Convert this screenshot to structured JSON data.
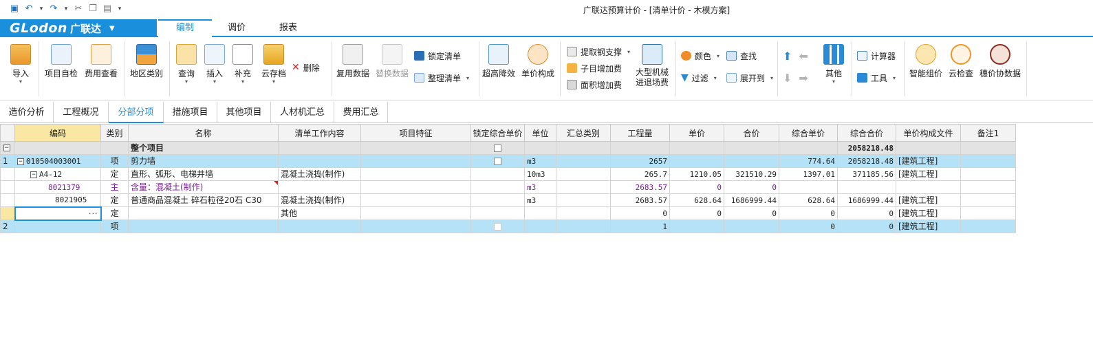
{
  "window": {
    "title": "广联达预算计价 - [清单计价 - 木模方案]"
  },
  "brand": {
    "logo_text": "GLodon",
    "logo_cn": "广联达",
    "accent": "#1a8fdc"
  },
  "ribbon_tabs": [
    {
      "label": "编制",
      "active": true
    },
    {
      "label": "调价",
      "active": false
    },
    {
      "label": "报表",
      "active": false
    }
  ],
  "toolbar": {
    "import": "导入",
    "project_check": "项目自检",
    "fee_view": "费用查看",
    "region": "地区类别",
    "query": "查询",
    "insert": "插入",
    "supplement": "补充",
    "cloud": "云存档",
    "delete": "删除",
    "reuse": "复用数据",
    "replace": "替换数据",
    "lock_list": "锁定清单",
    "organize_list": "整理清单",
    "rise_fall": "超高降效",
    "unit_price": "单价构成",
    "steel": "提取钢支撑",
    "sub_fee": "子目增加费",
    "area_fee": "面积增加费",
    "machinery": "大型机械\n进退场费",
    "color": "颜色",
    "find": "查找",
    "filter": "过滤",
    "expand": "展开到",
    "other": "其他",
    "calculator": "计算器",
    "tools": "工具",
    "smart_price": "智能组价",
    "cloud_check": "云检查",
    "suihe": "穗价协数据"
  },
  "page_tabs": [
    {
      "label": "造价分析",
      "active": false
    },
    {
      "label": "工程概况",
      "active": false
    },
    {
      "label": "分部分项",
      "active": true
    },
    {
      "label": "措施项目",
      "active": false
    },
    {
      "label": "其他项目",
      "active": false
    },
    {
      "label": "人材机汇总",
      "active": false
    },
    {
      "label": "费用汇总",
      "active": false
    }
  ],
  "table": {
    "columns": [
      "编码",
      "类别",
      "名称",
      "清单工作内容",
      "项目特征",
      "锁定综合单价",
      "单位",
      "汇总类别",
      "工程量",
      "单价",
      "合价",
      "综合单价",
      "综合合价",
      "单价构成文件",
      "备注1"
    ],
    "rows": [
      {
        "idx": "",
        "code": "",
        "type": "",
        "name": "整个项目",
        "work": "",
        "feature": "",
        "unit": "",
        "sum_type": "",
        "qty": "",
        "price": "",
        "total": "",
        "comp_price": "",
        "comp_total": "2058218.48",
        "file": "",
        "note": ""
      },
      {
        "idx": "1",
        "code": "010504003001",
        "type": "项",
        "name": "剪力墙",
        "work": "",
        "feature": "",
        "unit": "m3",
        "sum_type": "",
        "qty": "2657",
        "price": "",
        "total": "",
        "comp_price": "774.64",
        "comp_total": "2058218.48",
        "file": "[建筑工程]",
        "note": ""
      },
      {
        "idx": "",
        "code": "A4-12",
        "type": "定",
        "name": "直形、弧形、电梯井墙",
        "work": "混凝土浇捣(制作)",
        "feature": "",
        "unit": "10m3",
        "sum_type": "",
        "qty": "265.7",
        "price": "1210.05",
        "total": "321510.29",
        "comp_price": "1397.01",
        "comp_total": "371185.56",
        "file": "[建筑工程]",
        "note": ""
      },
      {
        "idx": "",
        "code": "8021379",
        "type": "主",
        "name": "含量：混凝土(制作)",
        "work": "",
        "feature": "",
        "unit": "m3",
        "sum_type": "",
        "qty": "2683.57",
        "price": "0",
        "total": "0",
        "comp_price": "",
        "comp_total": "",
        "file": "",
        "note": ""
      },
      {
        "idx": "",
        "code": "8021905",
        "type": "定",
        "name": "普通商品混凝土 碎石粒径20石 C30",
        "work": "混凝土浇捣(制作)",
        "feature": "",
        "unit": "m3",
        "sum_type": "",
        "qty": "2683.57",
        "price": "628.64",
        "total": "1686999.44",
        "comp_price": "628.64",
        "comp_total": "1686999.44",
        "file": "[建筑工程]",
        "note": ""
      },
      {
        "idx": "",
        "code": "",
        "type": "定",
        "name": "",
        "work": "其他",
        "feature": "",
        "unit": "",
        "sum_type": "",
        "qty": "0",
        "price": "0",
        "total": "0",
        "comp_price": "0",
        "comp_total": "0",
        "file": "[建筑工程]",
        "note": ""
      },
      {
        "idx": "2",
        "code": "",
        "type": "项",
        "name": "",
        "work": "",
        "feature": "",
        "unit": "",
        "sum_type": "",
        "qty": "1",
        "price": "",
        "total": "",
        "comp_price": "0",
        "comp_total": "0",
        "file": "[建筑工程]",
        "note": ""
      }
    ]
  }
}
